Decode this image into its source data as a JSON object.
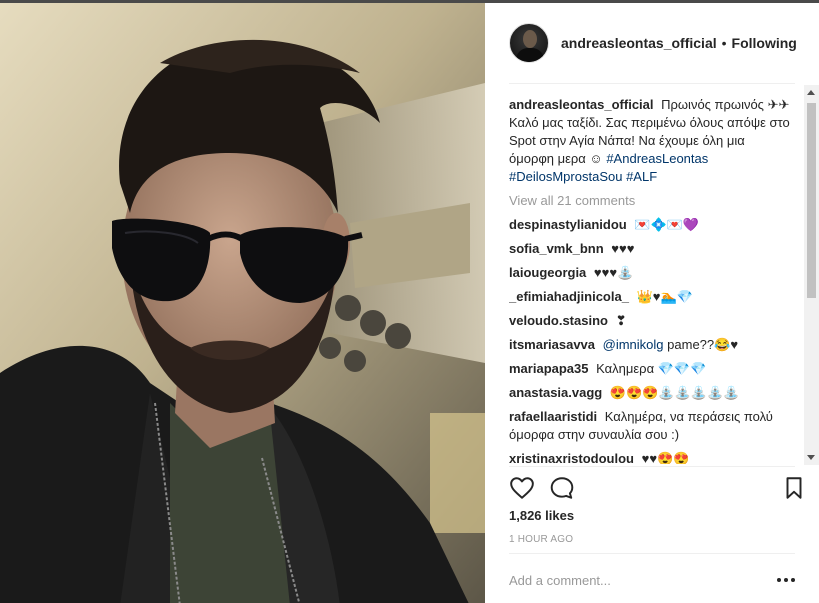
{
  "header": {
    "username": "andreasleontas_official",
    "separator": "•",
    "follow_status": "Following"
  },
  "caption": {
    "username": "andreasleontas_official",
    "text": "Πρωινός πρωινός ✈✈ Καλό μας ταξίδι. Σας περιμένω όλους απόψε στο Spot στην Αγία Νάπα! Να έχουμε όλη μια όμορφη μερα ☺",
    "hashtags": [
      "#AndreasLeontas",
      "#DeilosMprostaSou",
      "#ALF"
    ]
  },
  "view_all_comments": "View all 21 comments",
  "comments": [
    {
      "user": "despinastylianidou",
      "text": "💌💠💌💜"
    },
    {
      "user": "sofia_vmk_bnn",
      "text": "♥♥♥"
    },
    {
      "user": "laiougeorgia",
      "text": "♥♥♥⛲"
    },
    {
      "user": "_efimiahadjinicola_",
      "text": "👑♥🏊💎"
    },
    {
      "user": "veloudo.stasino",
      "text": "❣"
    },
    {
      "user": "itsmariasavva",
      "mention": "@imnikolg",
      "text": "pame??😂♥"
    },
    {
      "user": "mariapapa35",
      "text": "Καλημερα 💎💎💎"
    },
    {
      "user": "anastasia.vagg",
      "text": "😍😍😍⛲⛲⛲⛲⛲"
    },
    {
      "user": "rafaellaaristidi",
      "text": "Καλημέρα, να περάσεις πολύ όμορφα στην συναυλία σου :)"
    },
    {
      "user": "xristinaxristodoulou",
      "text": "♥♥😍😍"
    }
  ],
  "actions": {
    "like_icon": "heart-outline",
    "comment_icon": "speech-bubble-outline",
    "save_icon": "bookmark-outline"
  },
  "likes": "1,826 likes",
  "timestamp": "1 HOUR AGO",
  "add_comment": {
    "placeholder": "Add a comment..."
  },
  "colors": {
    "hashtag": "#003569",
    "muted": "#999999",
    "text": "#262626"
  }
}
